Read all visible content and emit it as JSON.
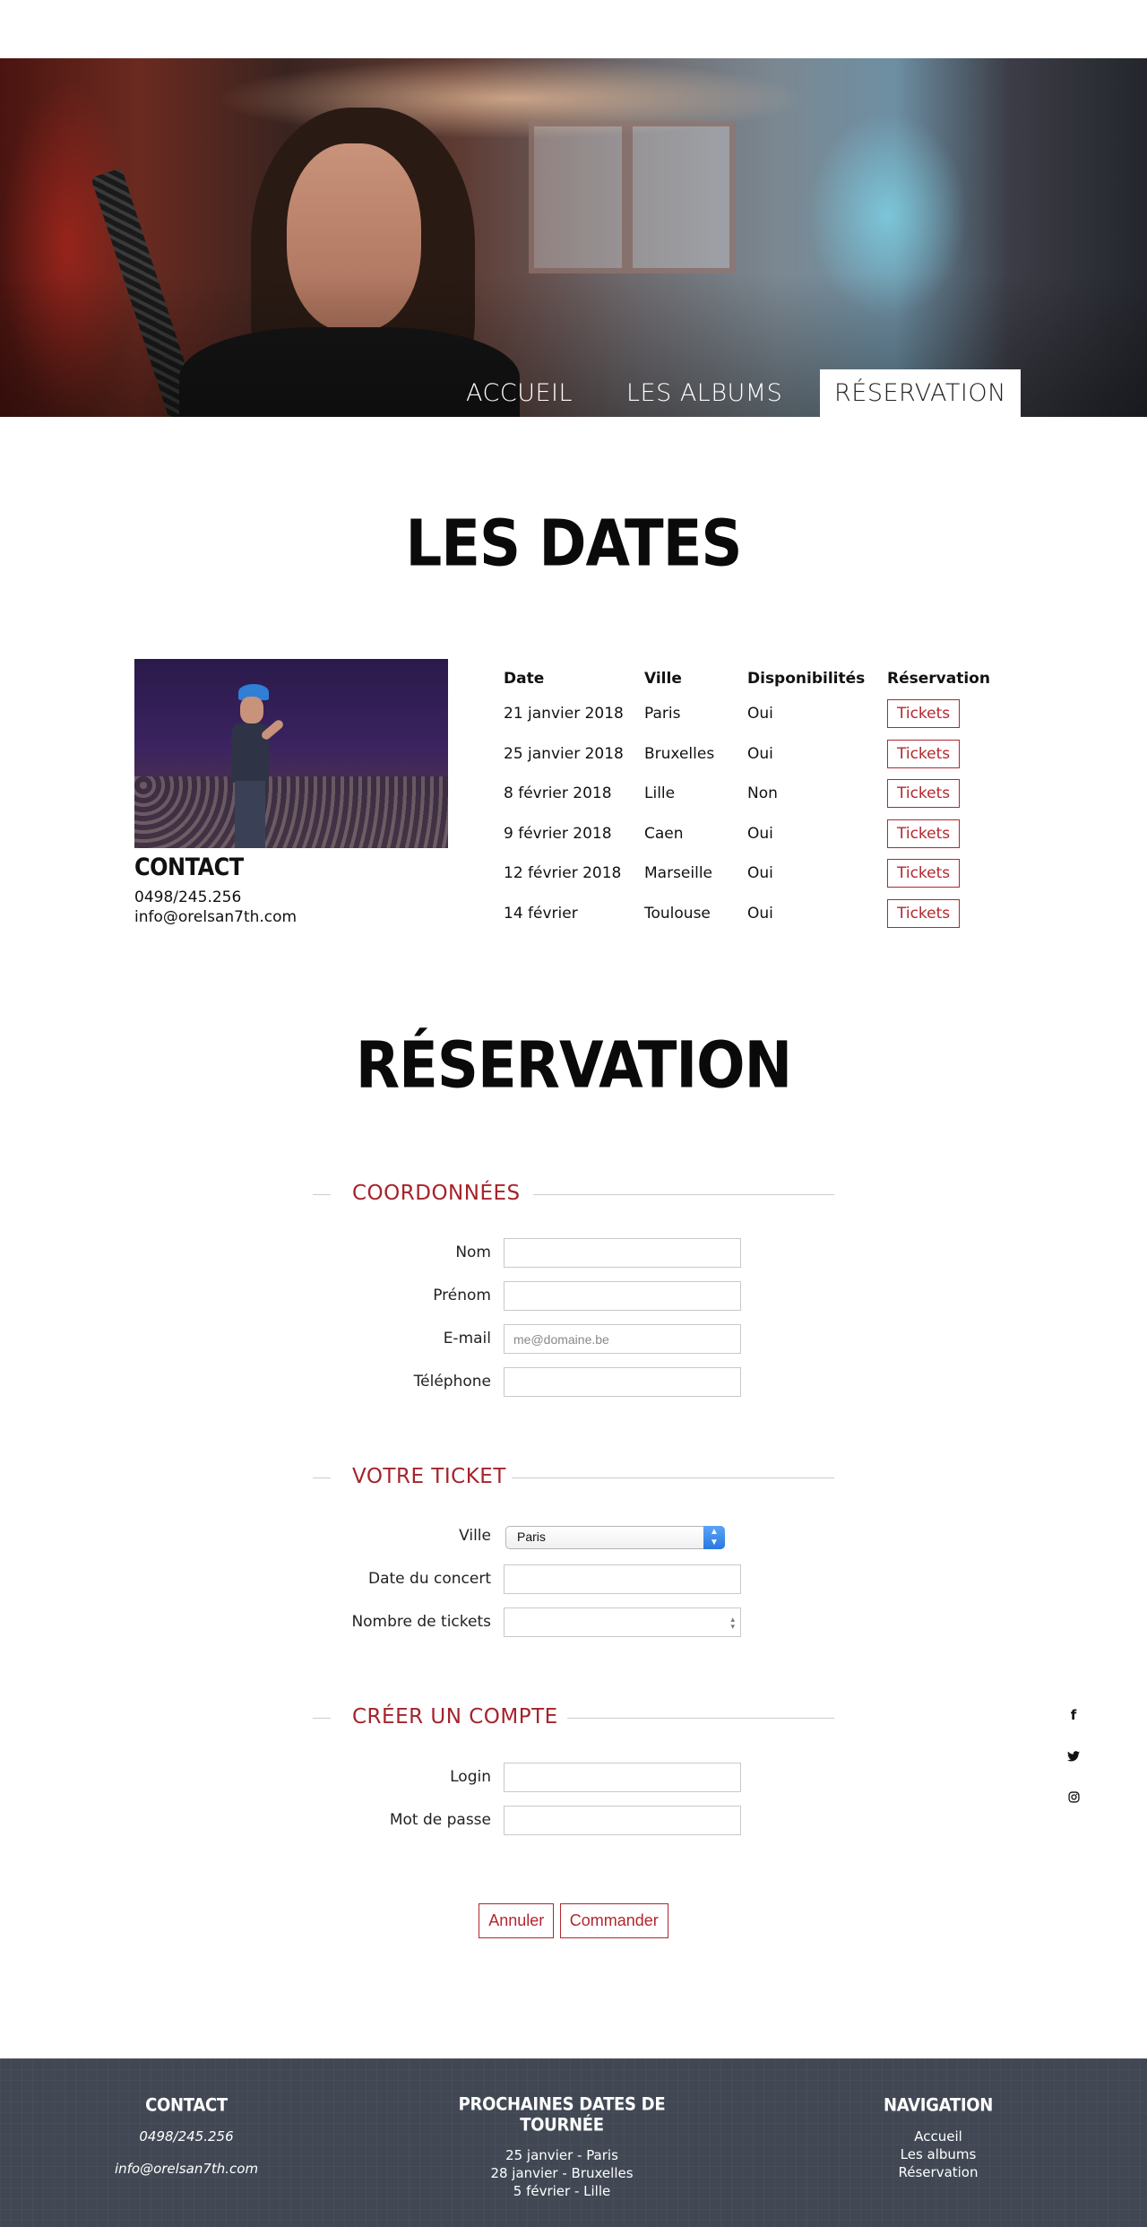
{
  "nav": {
    "items": [
      "ACCUEIL",
      "LES ALBUMS",
      "RÉSERVATION"
    ],
    "active": "RÉSERVATION"
  },
  "dates_section": {
    "title": "LES DATES",
    "contact": {
      "heading": "CONTACT",
      "phone": "0498/245.256",
      "email": "info@orelsan7th.com"
    },
    "table": {
      "headers": [
        "Date",
        "Ville",
        "Disponibilités",
        "Réservation"
      ],
      "rows": [
        {
          "date": "21 janvier 2018",
          "ville": "Paris",
          "dispo": "Oui",
          "btn": "Tickets"
        },
        {
          "date": "25 janvier 2018",
          "ville": "Bruxelles",
          "dispo": "Oui",
          "btn": "Tickets"
        },
        {
          "date": "8 février 2018",
          "ville": "Lille",
          "dispo": "Non",
          "btn": "Tickets"
        },
        {
          "date": "9 février 2018",
          "ville": "Caen",
          "dispo": "Oui",
          "btn": "Tickets"
        },
        {
          "date": "12 février 2018",
          "ville": "Marseille",
          "dispo": "Oui",
          "btn": "Tickets"
        },
        {
          "date": "14 février",
          "ville": "Toulouse",
          "dispo": "Oui",
          "btn": "Tickets"
        }
      ]
    }
  },
  "reservation": {
    "title": "RÉSERVATION",
    "coordonnees": {
      "legend": "COORDONNÉES",
      "nom": "Nom",
      "prenom": "Prénom",
      "email": "E-mail",
      "email_placeholder": "me@domaine.be",
      "telephone": "Téléphone"
    },
    "ticket": {
      "legend": "VOTRE TICKET",
      "ville": "Ville",
      "ville_selected": "Paris",
      "date": "Date du concert",
      "nombre": "Nombre de tickets"
    },
    "compte": {
      "legend": "CRÉER UN COMPTE",
      "login": "Login",
      "password": "Mot de passe"
    },
    "buttons": {
      "cancel": "Annuler",
      "order": "Commander"
    }
  },
  "social": [
    "facebook-icon",
    "twitter-icon",
    "instagram-icon"
  ],
  "footer": {
    "contact": {
      "heading": "CONTACT",
      "phone": "0498/245.256",
      "email": "info@orelsan7th.com"
    },
    "tour": {
      "heading": "PROCHAINES DATES DE TOURNÉE",
      "dates": [
        "25 janvier - Paris",
        "28 janvier - Bruxelles",
        "5 février - Lille"
      ]
    },
    "navigation": {
      "heading": "NAVIGATION",
      "links": [
        "Accueil",
        "Les albums",
        "Réservation"
      ]
    }
  },
  "colors": {
    "accent": "#a5232b",
    "footer_bg": "#414854"
  }
}
